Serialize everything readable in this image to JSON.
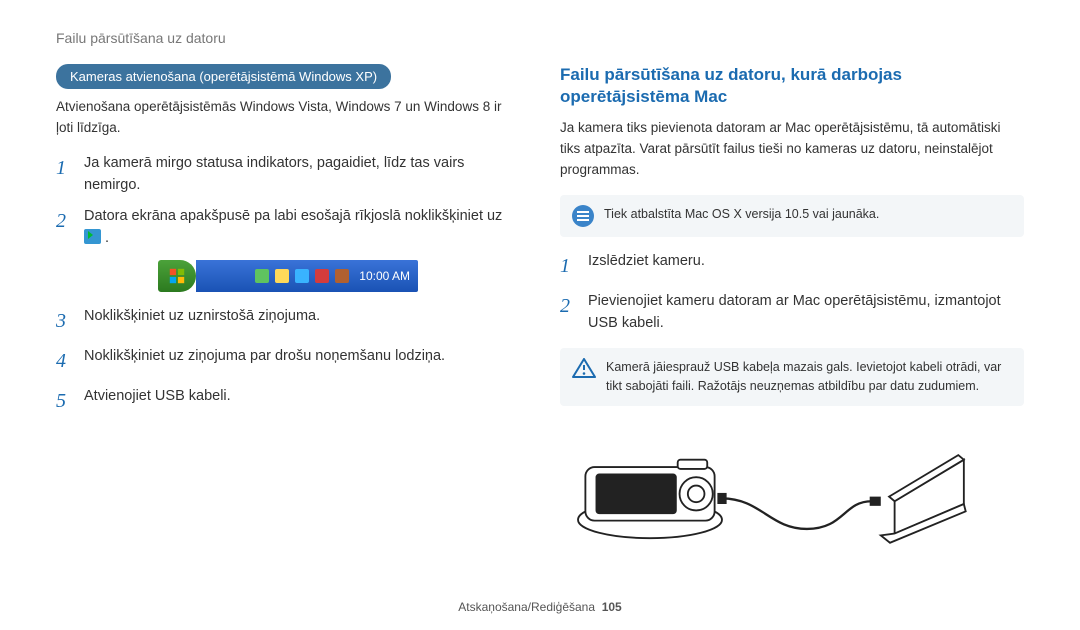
{
  "header": {
    "title": "Failu pārsūtīšana uz datoru"
  },
  "left": {
    "pill": "Kameras atvienošana (operētājsistēmā Windows XP)",
    "intro": "Atvienošana operētājsistēmās Windows Vista, Windows 7 un Windows 8 ir ļoti līdzīga.",
    "steps": [
      "Ja kamerā mirgo statusa indikators, pagaidiet, līdz tas vairs nemirgo.",
      "Datora ekrāna apakšpusē pa labi esošajā rīkjoslā noklikšķiniet uz",
      "Noklikšķiniet uz uznirstošā ziņojuma.",
      "Noklikšķiniet uz ziņojuma par drošu noņemšanu lodziņa.",
      "Atvienojiet USB kabeli."
    ],
    "taskbar_clock": "10:00 AM"
  },
  "right": {
    "heading": "Failu pārsūtīšana uz datoru, kurā darbojas operētājsistēma Mac",
    "intro": "Ja kamera tiks pievienota datoram ar Mac operētājsistēmu, tā automātiski tiks atpazīta. Varat pārsūtīt failus tieši no kameras uz datoru, neinstalējot programmas.",
    "info_note": "Tiek atbalstīta Mac OS X versija 10.5 vai jaunāka.",
    "steps": [
      "Izslēdziet kameru.",
      "Pievienojiet kameru datoram ar Mac operētājsistēmu, izmantojot USB kabeli."
    ],
    "warn_note": "Kamerā jāiesprauž USB kabeļa mazais gals. Ievietojot kabeli otrādi, var tikt sabojāti faili. Ražotājs neuzņemas atbildību par datu zudumiem."
  },
  "footer": {
    "section": "Atskaņošana/Rediģēšana",
    "page": "105"
  }
}
